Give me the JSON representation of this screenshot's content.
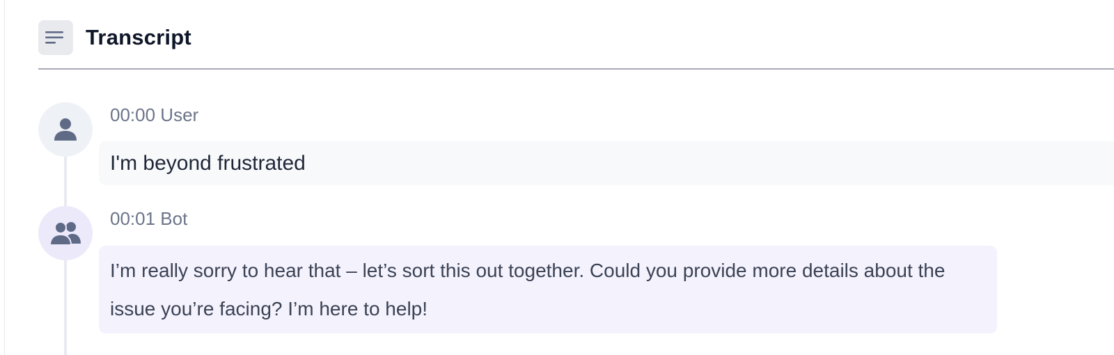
{
  "header": {
    "icon": "transcript-lines-icon",
    "title": "Transcript"
  },
  "messages": [
    {
      "time": "00:00",
      "speaker": "User",
      "meta": "00:00 User",
      "avatar_icon": "person-icon",
      "text": "I'm beyond frustrated"
    },
    {
      "time": "00:01",
      "speaker": "Bot",
      "meta": "00:01 Bot",
      "avatar_icon": "people-icon",
      "text": "I’m really sorry to hear that – let’s sort this out together. Could you provide more details about the issue you’re facing? I’m here to help!"
    }
  ],
  "colors": {
    "title": "#0f1628",
    "meta": "#6b7489",
    "user_bubble": "#f8f9fb",
    "bot_bubble": "#f4f2fd",
    "user_avatar_bg": "#eef1f6",
    "bot_avatar_bg": "#ece9fb",
    "icon": "#5f6a86",
    "divider": "#a7a9b6"
  }
}
